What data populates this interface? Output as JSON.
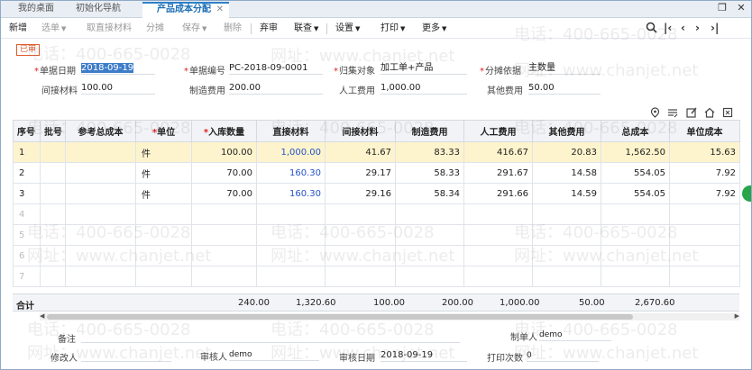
{
  "tabs": [
    {
      "label": "我的桌面"
    },
    {
      "label": "初始化导航"
    },
    {
      "label": "产品成本分配",
      "close": "✕"
    }
  ],
  "window_controls": {
    "restore": "❐",
    "close": "✕"
  },
  "toolbar": {
    "new": "新增",
    "select_doc": "选单",
    "fetch_indirect": "取直接材料",
    "allocate": "分摊",
    "save": "保存",
    "delete": "删除",
    "abandon": "弃审",
    "related": "联查",
    "settings": "设置",
    "print": "打印",
    "more": "更多"
  },
  "status_stamp": "已审",
  "header": {
    "doc_date_label": "单据日期",
    "doc_date": "2018-09-19",
    "doc_no_label": "单据编号",
    "doc_no": "PC-2018-09-0001",
    "collect_obj_label": "归集对象",
    "collect_obj": "加工单+产品",
    "alloc_basis_label": "分摊依据",
    "alloc_basis": "主数量",
    "indirect_mat_label": "间接材料",
    "indirect_mat": "100.00",
    "mfg_cost_label": "制造费用",
    "mfg_cost": "200.00",
    "labor_label": "人工费用",
    "labor": "1,000.00",
    "other_label": "其他费用",
    "other": "50.00"
  },
  "table": {
    "columns": [
      "序号",
      "批号",
      "参考总成本",
      "单位",
      "入库数量",
      "直接材料",
      "间接材料",
      "制造费用",
      "人工费用",
      "其他费用",
      "总成本",
      "单位成本"
    ],
    "rows": [
      {
        "no": "1",
        "batch": "",
        "ref": "",
        "unit": "件",
        "qty": "100.00",
        "direct": "1,000.00",
        "indirect": "41.67",
        "mfg": "83.33",
        "labor": "416.67",
        "other": "20.83",
        "total": "1,562.50",
        "unit_cost": "15.63"
      },
      {
        "no": "2",
        "batch": "",
        "ref": "",
        "unit": "件",
        "qty": "70.00",
        "direct": "160.30",
        "indirect": "29.17",
        "mfg": "58.33",
        "labor": "291.67",
        "other": "14.58",
        "total": "554.05",
        "unit_cost": "7.92"
      },
      {
        "no": "3",
        "batch": "",
        "ref": "",
        "unit": "件",
        "qty": "70.00",
        "direct": "160.30",
        "indirect": "29.16",
        "mfg": "58.34",
        "labor": "291.66",
        "other": "14.59",
        "total": "554.05",
        "unit_cost": "7.92"
      }
    ],
    "empty_rows": [
      "4",
      "5",
      "6",
      "7"
    ]
  },
  "totals": {
    "label": "合计",
    "qty": "240.00",
    "direct": "1,320.60",
    "indirect": "100.00",
    "mfg": "200.00",
    "labor": "1,000.00",
    "other": "50.00",
    "total": "2,670.60"
  },
  "footer": {
    "remark_label": "备注",
    "maker_label": "制单人",
    "maker": "demo",
    "modifier_label": "修改人",
    "auditor_label": "审核人",
    "auditor": "demo",
    "audit_date_label": "审核日期",
    "audit_date": "2018-09-19",
    "print_count_label": "打印次数",
    "print_count": "0"
  },
  "watermark": {
    "phone": "电话：400-665-0028",
    "site": "网址：www.chanjet.net"
  },
  "colors": {
    "accent": "#2f80c7",
    "highlight_row": "#fdf4cd",
    "required": "#e02020",
    "stamp": "#e05a2a"
  }
}
